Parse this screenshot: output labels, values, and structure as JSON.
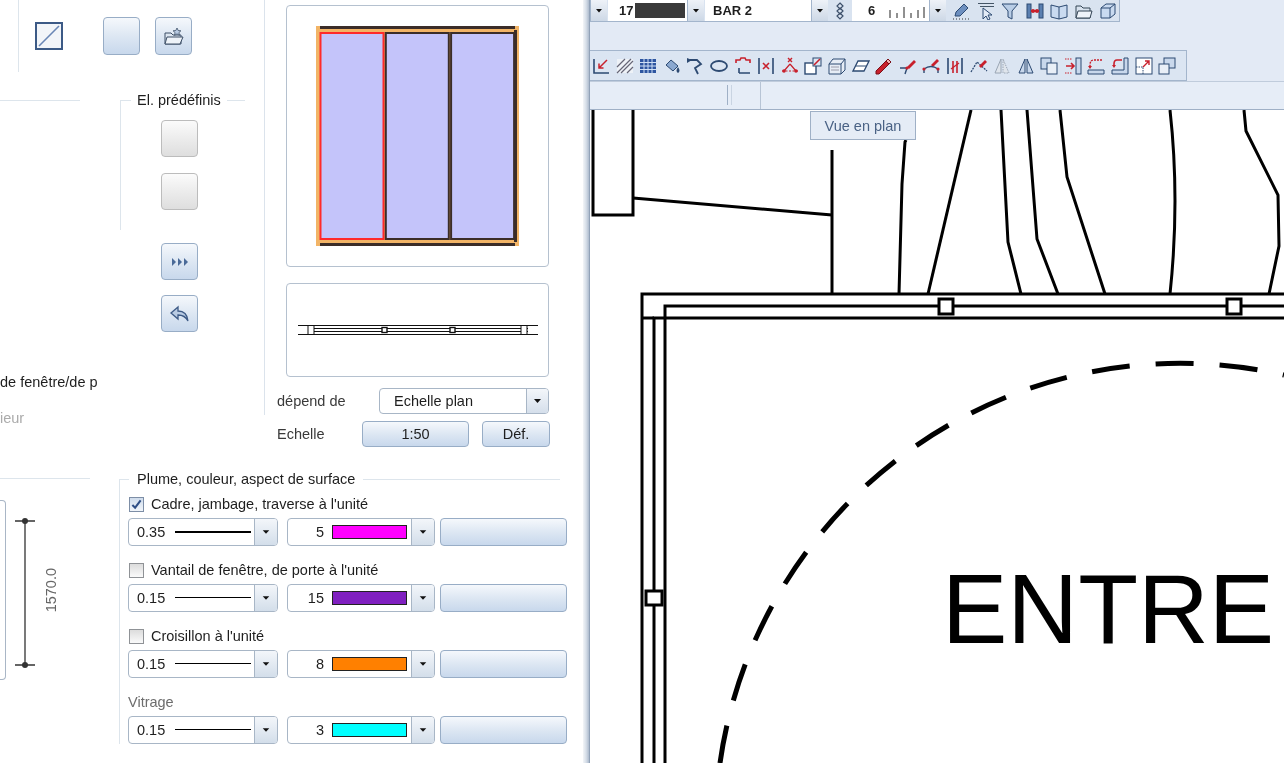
{
  "options_panel": {
    "predefined": {
      "title": "El. prédéfinis",
      "buttons": [
        {
          "disabled": true
        },
        {
          "disabled": true
        }
      ]
    },
    "texts": [
      {
        "text": "de fenêtre/de p",
        "disabled": false
      },
      {
        "text": "ieur",
        "disabled": true
      }
    ],
    "dimension": "1570.0"
  },
  "preview": {
    "panes": [
      {
        "selected": true
      },
      {
        "selected": false
      },
      {
        "selected": false
      }
    ],
    "depends_label": "dépend de",
    "depends_value": "Echelle plan",
    "scale_label": "Echelle",
    "scale_value": "1:50",
    "define_button": "Déf."
  },
  "pen_group": {
    "title": "Plume, couleur, aspect de surface",
    "rows": [
      {
        "kind": "checkbox",
        "label": "Cadre, jambage, traverse à l'unité",
        "checked": true,
        "pen": "0.35",
        "color_number": "5",
        "color": "#ff00ff"
      },
      {
        "kind": "checkbox",
        "label": "Vantail de fenêtre, de porte à l'unité",
        "checked": false,
        "pen": "0.15",
        "color_number": "15",
        "color": "#8020c0"
      },
      {
        "kind": "checkbox",
        "label": "Croisillon à l'unité",
        "checked": false,
        "pen": "0.15",
        "color_number": "8",
        "color": "#ff8000"
      },
      {
        "kind": "label",
        "label": "Vitrage",
        "pen": "0.15",
        "color_number": "3",
        "color": "#00ffff"
      }
    ]
  },
  "toolbar": {
    "pen_number": "17",
    "line_type": "BAR 2",
    "line_number": "6"
  },
  "tooltip": "Vue en plan",
  "drawing": {
    "label": "ENTRE"
  }
}
